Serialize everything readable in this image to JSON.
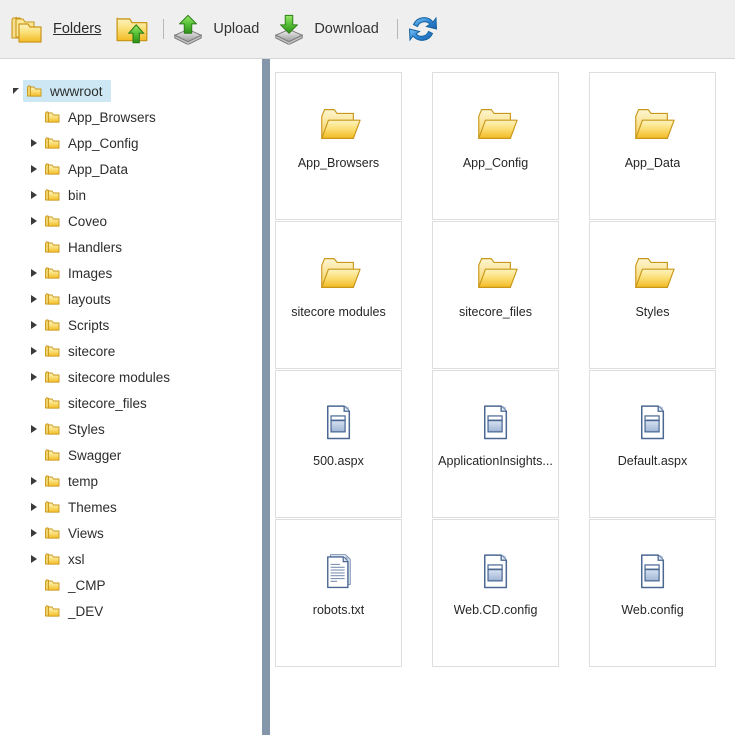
{
  "toolbar": {
    "items": [
      {
        "icon": "folders-stack-icon",
        "label": "Folders",
        "link": true
      },
      {
        "icon": "folder-upload-icon",
        "label": "",
        "link": false
      },
      {
        "icon": "upload-icon",
        "label": "Upload",
        "link": false
      },
      {
        "icon": "download-icon",
        "label": "Download",
        "link": false
      },
      {
        "icon": "refresh-icon",
        "label": "",
        "link": false
      }
    ]
  },
  "tree": {
    "nodes": [
      {
        "label": "wwwroot",
        "depth": 0,
        "state": "expanded",
        "selected": true
      },
      {
        "label": "App_Browsers",
        "depth": 1,
        "state": "leaf",
        "selected": false
      },
      {
        "label": "App_Config",
        "depth": 1,
        "state": "collapsed",
        "selected": false
      },
      {
        "label": "App_Data",
        "depth": 1,
        "state": "collapsed",
        "selected": false
      },
      {
        "label": "bin",
        "depth": 1,
        "state": "collapsed",
        "selected": false
      },
      {
        "label": "Coveo",
        "depth": 1,
        "state": "collapsed",
        "selected": false
      },
      {
        "label": "Handlers",
        "depth": 1,
        "state": "leaf",
        "selected": false
      },
      {
        "label": "Images",
        "depth": 1,
        "state": "collapsed",
        "selected": false
      },
      {
        "label": "layouts",
        "depth": 1,
        "state": "collapsed",
        "selected": false
      },
      {
        "label": "Scripts",
        "depth": 1,
        "state": "collapsed",
        "selected": false
      },
      {
        "label": "sitecore",
        "depth": 1,
        "state": "collapsed",
        "selected": false
      },
      {
        "label": "sitecore modules",
        "depth": 1,
        "state": "collapsed",
        "selected": false
      },
      {
        "label": "sitecore_files",
        "depth": 1,
        "state": "leaf",
        "selected": false
      },
      {
        "label": "Styles",
        "depth": 1,
        "state": "collapsed",
        "selected": false
      },
      {
        "label": "Swagger",
        "depth": 1,
        "state": "leaf",
        "selected": false
      },
      {
        "label": "temp",
        "depth": 1,
        "state": "collapsed",
        "selected": false
      },
      {
        "label": "Themes",
        "depth": 1,
        "state": "collapsed",
        "selected": false
      },
      {
        "label": "Views",
        "depth": 1,
        "state": "collapsed",
        "selected": false
      },
      {
        "label": "xsl",
        "depth": 1,
        "state": "collapsed",
        "selected": false
      },
      {
        "label": "_CMP",
        "depth": 1,
        "state": "leaf",
        "selected": false
      },
      {
        "label": "_DEV",
        "depth": 1,
        "state": "leaf",
        "selected": false
      }
    ]
  },
  "content": {
    "tiles": [
      {
        "label": "App_Browsers",
        "icon": "folder-icon"
      },
      {
        "label": "App_Config",
        "icon": "folder-icon"
      },
      {
        "label": "App_Data",
        "icon": "folder-icon"
      },
      {
        "label": "sitecore modules",
        "icon": "folder-icon"
      },
      {
        "label": "sitecore_files",
        "icon": "folder-icon"
      },
      {
        "label": "Styles",
        "icon": "folder-icon"
      },
      {
        "label": "500.aspx",
        "icon": "aspx-file-icon"
      },
      {
        "label": "ApplicationInsights...",
        "icon": "aspx-file-icon"
      },
      {
        "label": "Default.aspx",
        "icon": "aspx-file-icon"
      },
      {
        "label": "robots.txt",
        "icon": "text-file-icon"
      },
      {
        "label": "Web.CD.config",
        "icon": "aspx-file-icon"
      },
      {
        "label": "Web.config",
        "icon": "aspx-file-icon"
      }
    ]
  },
  "colors": {
    "toolbar_bg": "#efefef",
    "splitter": "#8496aa",
    "selection": "#cde8f4",
    "tile_border": "#dedede",
    "folder_gold": "#f5c93a",
    "arrow_green": "#55c036",
    "refresh_blue": "#2f88d8"
  }
}
